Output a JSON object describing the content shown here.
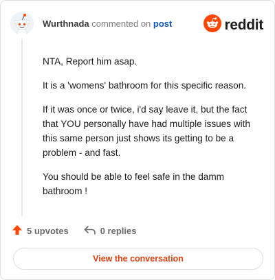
{
  "header": {
    "author": "Wurthnada",
    "action_text": "commented on",
    "post_link": "post",
    "brand_name": "reddit"
  },
  "comment": {
    "paragraphs": [
      "NTA, Report him asap.",
      "It is a 'womens' bathroom for this specific reason.",
      "If it was once or twice, i'd say leave it, but the fact that YOU personally have had multiple issues with this same person just shows its getting to be a problem - and fast.",
      "You should be able to feel safe in the damm bathroom !"
    ]
  },
  "footer": {
    "upvotes": "5 upvotes",
    "replies": "0 replies",
    "cta_label": "View the conversation"
  },
  "icons": {
    "avatar": "snoo-avatar-icon",
    "brand": "reddit-logo-icon",
    "upvote": "upvote-arrow-icon",
    "reply": "reply-arrow-icon"
  },
  "colors": {
    "brand_orange": "#ff4500",
    "link_blue": "#0b55b8",
    "cta_text": "#e23d0b"
  }
}
